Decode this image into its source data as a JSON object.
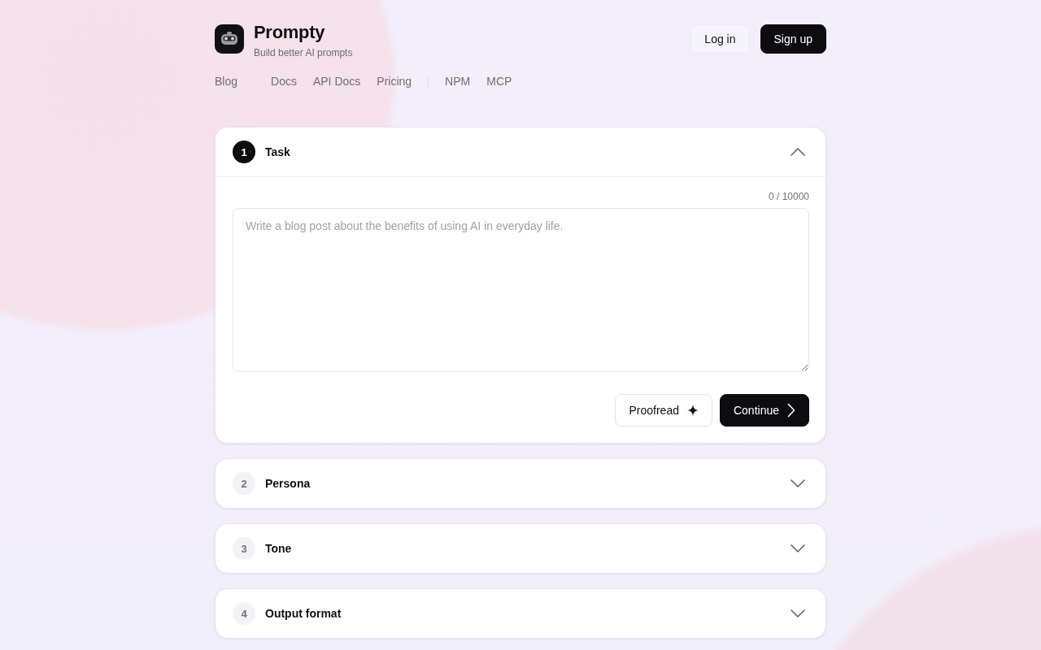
{
  "brand": {
    "name": "Prompty",
    "tagline": "Build better AI prompts"
  },
  "nav": [
    {
      "divider": false,
      "links": [
        "Blog"
      ]
    },
    {
      "divider": false,
      "links": [
        "Docs",
        "API Docs",
        "Pricing"
      ]
    },
    {
      "divider": true,
      "links": [
        "NPM",
        "MCP"
      ]
    }
  ],
  "auth": [
    {
      "label": "Log in",
      "kind": "secondary"
    },
    {
      "label": "Sign up",
      "kind": "primary"
    }
  ],
  "steps": [
    {
      "number": "1",
      "title": "Task",
      "expanded": true,
      "counter": "0 / 10000",
      "placeholder": "Write a blog post about the benefits of using AI in everyday life.",
      "actions": [
        {
          "label": "Proofread",
          "kind": "secondary"
        },
        {
          "label": "Continue",
          "kind": "primary"
        }
      ]
    },
    {
      "number": "2",
      "title": "Persona",
      "expanded": false
    },
    {
      "number": "3",
      "title": "Tone",
      "expanded": false
    },
    {
      "number": "4",
      "title": "Output format",
      "expanded": false
    }
  ]
}
